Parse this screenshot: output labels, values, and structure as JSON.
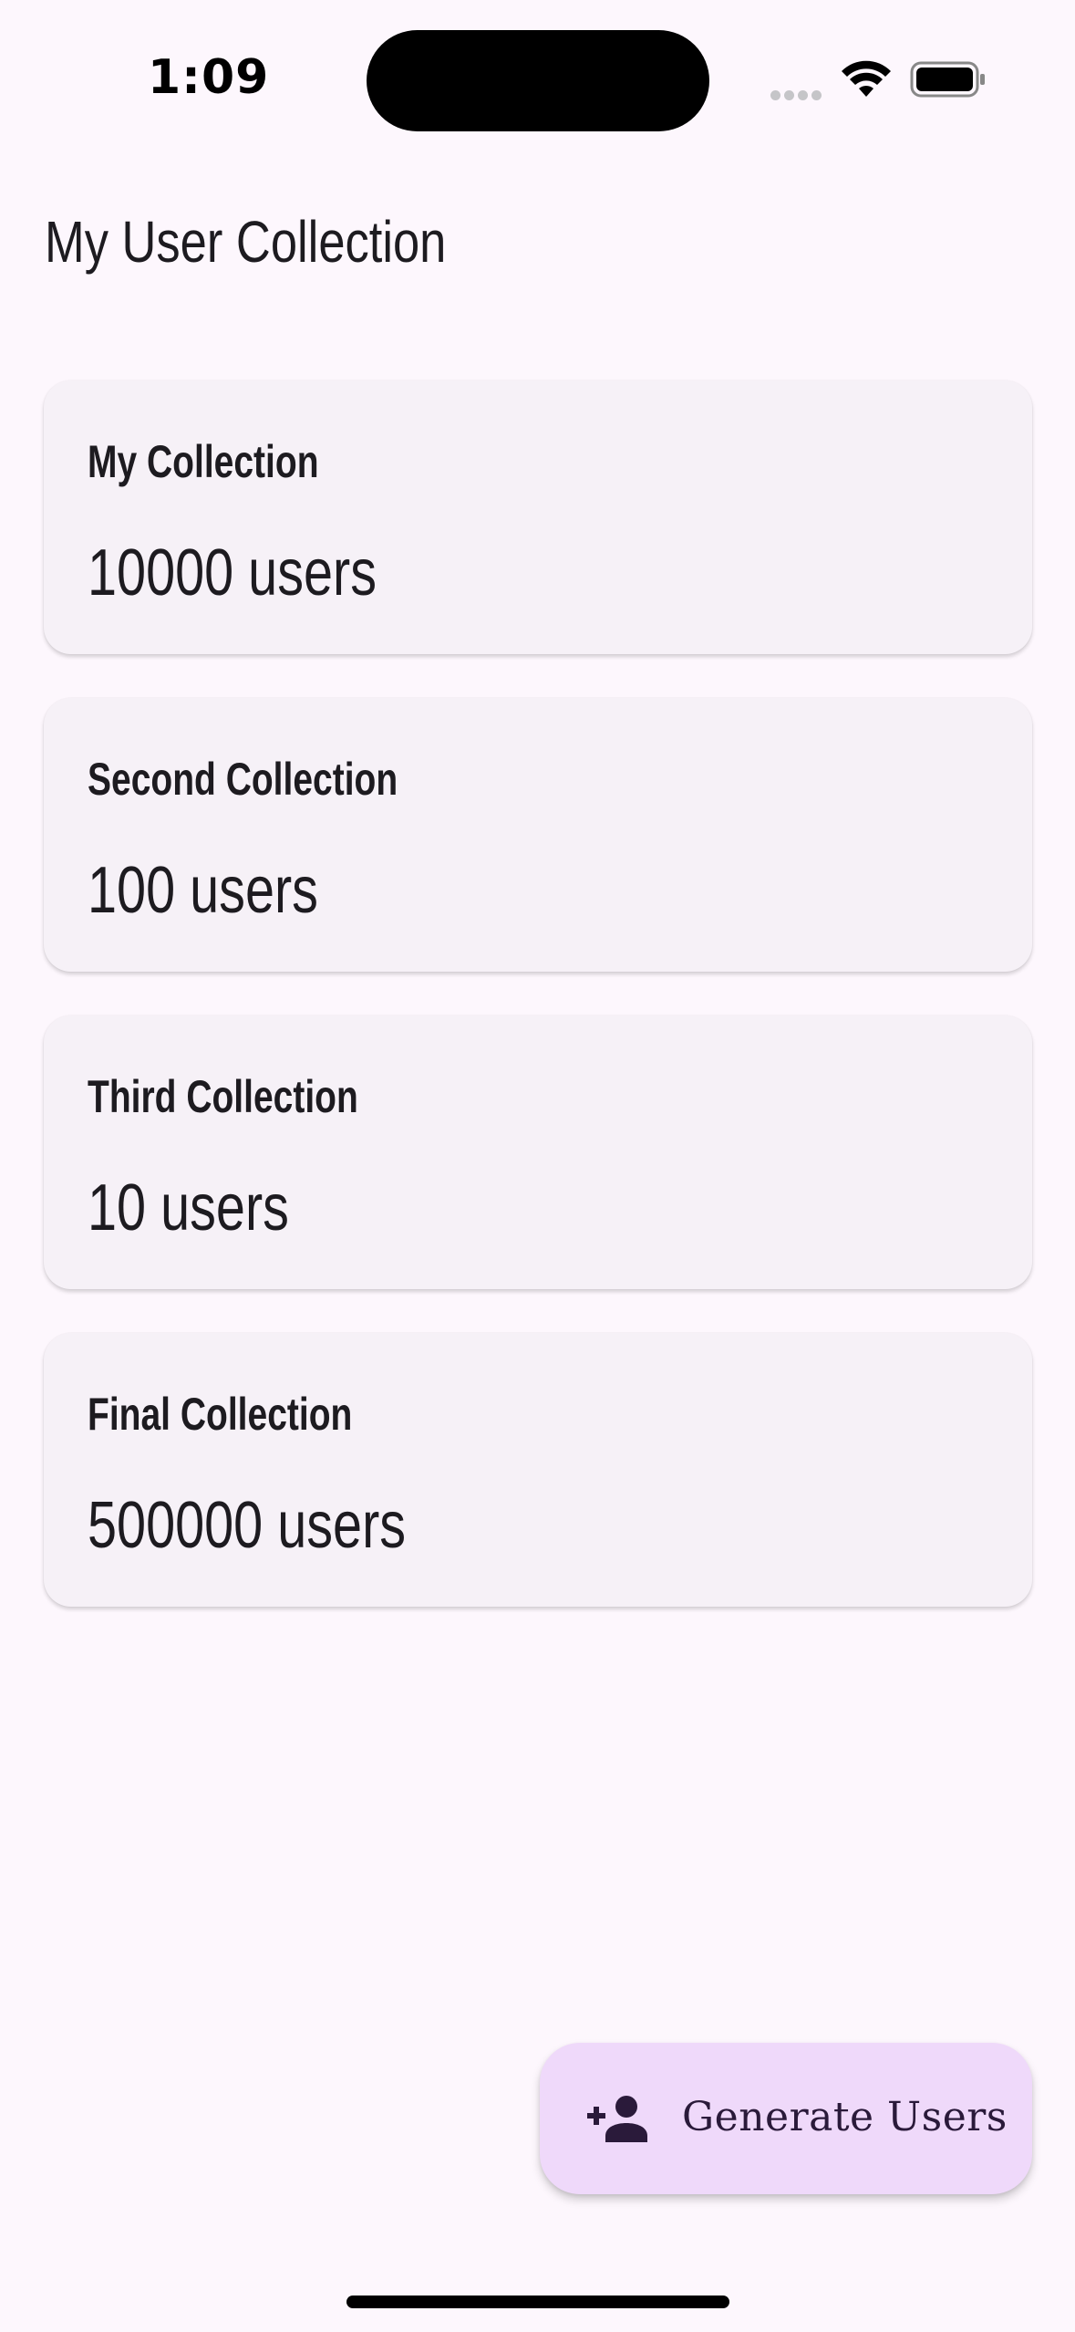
{
  "status_bar": {
    "time": "1:09"
  },
  "header": {
    "title": "My User Collection"
  },
  "collections": [
    {
      "title": "My Collection",
      "count": "10000 users"
    },
    {
      "title": "Second Collection",
      "count": "100 users"
    },
    {
      "title": "Third Collection",
      "count": "10 users"
    },
    {
      "title": "Final Collection",
      "count": "500000 users"
    }
  ],
  "fab": {
    "label": "Generate Users",
    "icon": "person-add-icon"
  },
  "colors": {
    "background": "#fdf7fd",
    "card": "#f6f1f7",
    "fab": "#efd9fa",
    "text": "#1d1b20"
  }
}
